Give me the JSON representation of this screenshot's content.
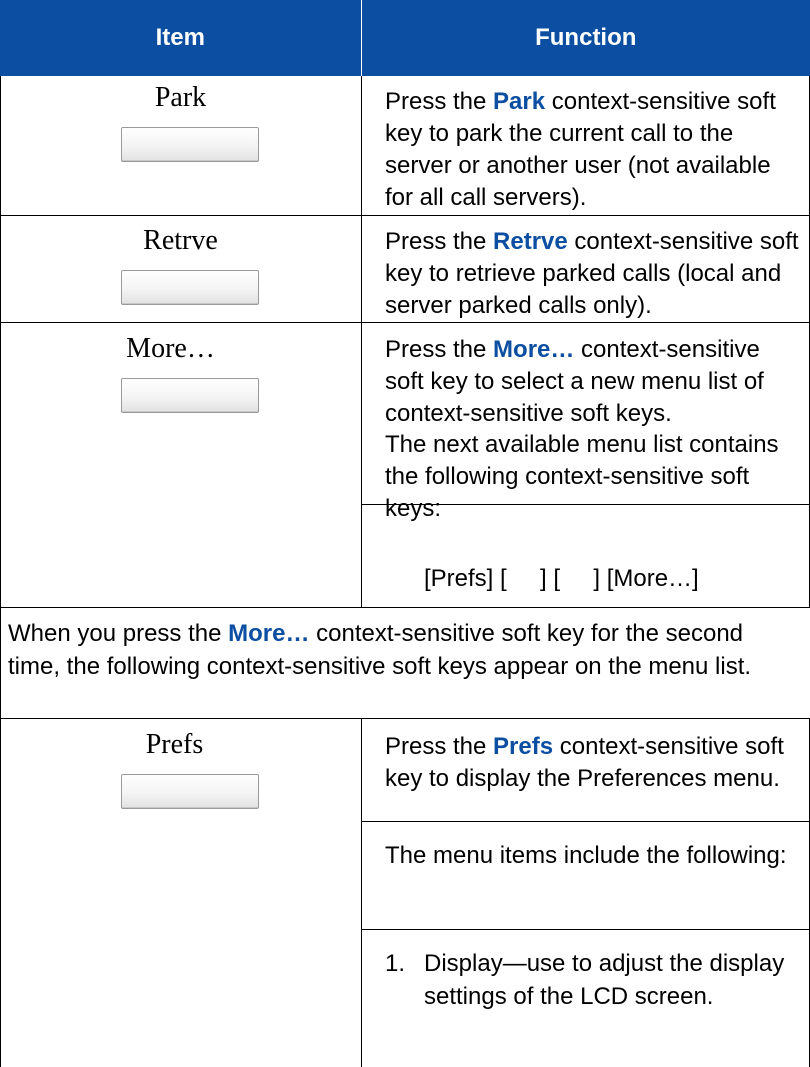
{
  "table": {
    "headers": {
      "item": "Item",
      "function": "Function"
    },
    "rows": [
      {
        "key": "Park",
        "desc_pre": "Press the ",
        "desc_kw": "Park",
        "desc_post": " context-sensitive soft key to park the current call to the server or another user (not available for all call servers)."
      },
      {
        "key": "Retrve",
        "desc_pre": "Press the ",
        "desc_kw": "Retrve",
        "desc_post": " context-sensitive soft key to retrieve parked calls (local and server parked calls only)."
      },
      {
        "key": "More…",
        "desc_pre": "Press the ",
        "desc_kw": "More…",
        "desc_post": " context-sensitive soft key to select a new menu list of context-sensitive soft keys.",
        "desc2": "The next available menu list contains the following context-sensitive soft keys:",
        "keys_list": "[Prefs] [     ] [     ] [More…]"
      }
    ],
    "span_row": {
      "pre": "When you press the ",
      "kw": "More…",
      "post": " context-sensitive soft key for the second time, the following context-sensitive soft keys appear on the menu list."
    },
    "prefs_row": {
      "key": "Prefs",
      "desc_pre": "Press the ",
      "desc_kw": "Prefs",
      "desc_post": " context-sensitive soft key to display the Preferences menu.",
      "desc2": "The menu items include the following:",
      "list": [
        {
          "num": "1.",
          "text": "Display—use to adjust the display settings of the LCD screen."
        }
      ]
    }
  }
}
